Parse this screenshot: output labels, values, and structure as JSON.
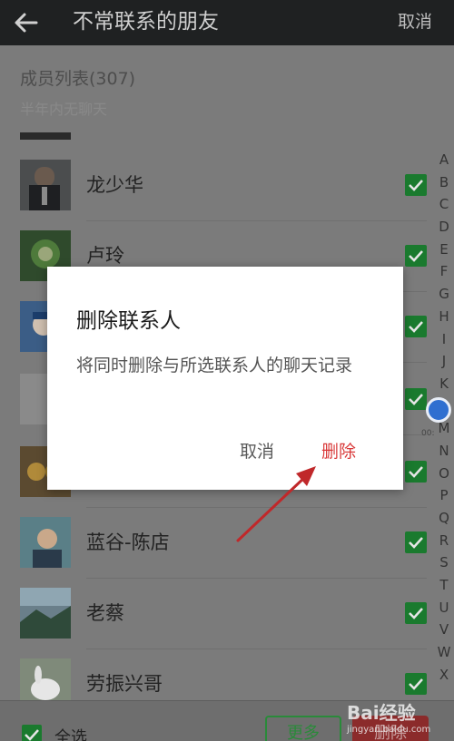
{
  "header": {
    "title": "不常联系的朋友",
    "cancel_label": "取消"
  },
  "members": {
    "header": "成员列表(307)",
    "subtitle": "半年内无聊天"
  },
  "rows": [
    {
      "name": "龙少华",
      "checked": true
    },
    {
      "name": "卢玲",
      "checked": true
    },
    {
      "name": "",
      "checked": true
    },
    {
      "name": "",
      "checked": true
    },
    {
      "name": "",
      "checked": true
    },
    {
      "name": "蓝谷-陈店",
      "checked": true
    },
    {
      "name": "老蔡",
      "checked": true
    },
    {
      "name": "劳振兴哥",
      "checked": true
    }
  ],
  "index_letters": [
    "A",
    "B",
    "C",
    "D",
    "E",
    "F",
    "G",
    "H",
    "I",
    "J",
    "K",
    "L",
    "M",
    "N",
    "O",
    "P",
    "Q",
    "R",
    "S",
    "T",
    "U",
    "V",
    "W",
    "X"
  ],
  "scroll_label": "00:",
  "bottom": {
    "select_all_label": "全选",
    "more_label": "更多",
    "delete_label": "删除"
  },
  "dialog": {
    "title": "删除联系人",
    "message": "将同时删除与所选联系人的聊天记录",
    "cancel_label": "取消",
    "delete_label": "删除"
  },
  "watermark": {
    "line1": "Bai经验",
    "line2": "jingyan.baidu.com"
  },
  "colors": {
    "accent_green": "#1a7a2e",
    "danger_red": "#d93a3a",
    "arrow_red": "#c0282a"
  }
}
